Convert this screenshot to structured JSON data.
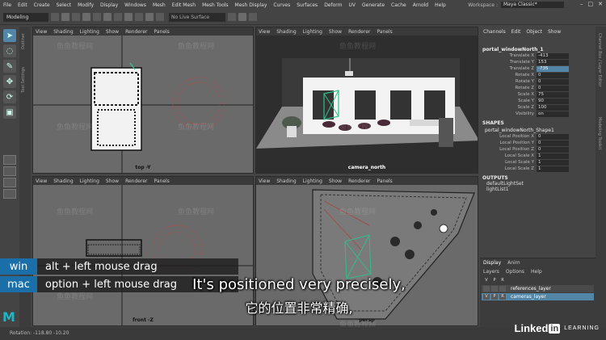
{
  "menubar": {
    "items": [
      "File",
      "Edit",
      "Create",
      "Select",
      "Modify",
      "Display",
      "Windows",
      "Mesh",
      "Edit Mesh",
      "Mesh Tools",
      "Mesh Display",
      "Curves",
      "Surfaces",
      "Deform",
      "UV",
      "Generate",
      "Cache",
      "Arnold",
      "Help"
    ],
    "workspace_label": "Workspace :",
    "workspace_value": "Maya Classic*"
  },
  "statusline": {
    "mode": "Modeling",
    "live_surface": "No Live Surface"
  },
  "side_tabs": {
    "left_top": "Outliner",
    "left_bottom": "Tool Settings"
  },
  "viewports": {
    "menu": [
      "View",
      "Shading",
      "Lighting",
      "Show",
      "Renderer",
      "Panels"
    ],
    "top": {
      "label": "top -Y"
    },
    "camera": {
      "label": "camera_north"
    },
    "front": {
      "label": "front -Z"
    },
    "persp": {
      "label": "persp"
    }
  },
  "channel_box": {
    "menu": [
      "Channels",
      "Edit",
      "Object",
      "Show"
    ],
    "object": "portal_windowNorth_1",
    "attributes": [
      {
        "name": "Translate X",
        "value": "-413"
      },
      {
        "name": "Translate Y",
        "value": "153"
      },
      {
        "name": "Translate Z",
        "value": "-735",
        "highlight": true
      },
      {
        "name": "Rotate X",
        "value": "0"
      },
      {
        "name": "Rotate Y",
        "value": "0"
      },
      {
        "name": "Rotate Z",
        "value": "0"
      },
      {
        "name": "Scale X",
        "value": "75"
      },
      {
        "name": "Scale Y",
        "value": "90"
      },
      {
        "name": "Scale Z",
        "value": "100"
      },
      {
        "name": "Visibility",
        "value": "on"
      }
    ],
    "shapes_label": "SHAPES",
    "shape_name": "portal_windowNorth_Shape1",
    "shape_attributes": [
      {
        "name": "Local Position X",
        "value": "0"
      },
      {
        "name": "Local Position Y",
        "value": "0"
      },
      {
        "name": "Local Position Z",
        "value": "0"
      },
      {
        "name": "Local Scale X",
        "value": "1"
      },
      {
        "name": "Local Scale Y",
        "value": "1"
      },
      {
        "name": "Local Scale Z",
        "value": "1"
      }
    ],
    "outputs_label": "OUTPUTS",
    "outputs": [
      "defaultLightSet",
      "lightList1"
    ]
  },
  "layer_editor": {
    "tabs": [
      "Display",
      "Anim"
    ],
    "menu": [
      "Layers",
      "Options",
      "Help"
    ],
    "layers": [
      {
        "v": "",
        "p": "",
        "r": "",
        "name": "references_layer",
        "selected": false
      },
      {
        "v": "V",
        "p": "P",
        "r": "R",
        "name": "cameras_layer",
        "selected": true
      }
    ],
    "header": {
      "v": "V",
      "p": "P",
      "r": "R"
    }
  },
  "right_tabs": [
    "Channel Box / Layer Editor",
    "Modeling Toolkit"
  ],
  "helpline": "Rotation: -118.80 -10.20",
  "keycaps": [
    {
      "os": "win",
      "command": "alt + left mouse drag"
    },
    {
      "os": "mac",
      "command": "option + left mouse drag"
    }
  ],
  "subtitles": {
    "en": "It's positioned very precisely,",
    "zh": "它的位置非常精确,"
  },
  "watermark": "鱼鱼教程网",
  "brand": {
    "name": "Linked",
    "in": "in",
    "tagline": "LEARNING"
  },
  "icons": [
    "select-icon",
    "lasso-icon",
    "paint-select-icon",
    "move-icon",
    "rotate-icon",
    "scale-icon",
    "maya-logo-icon"
  ]
}
